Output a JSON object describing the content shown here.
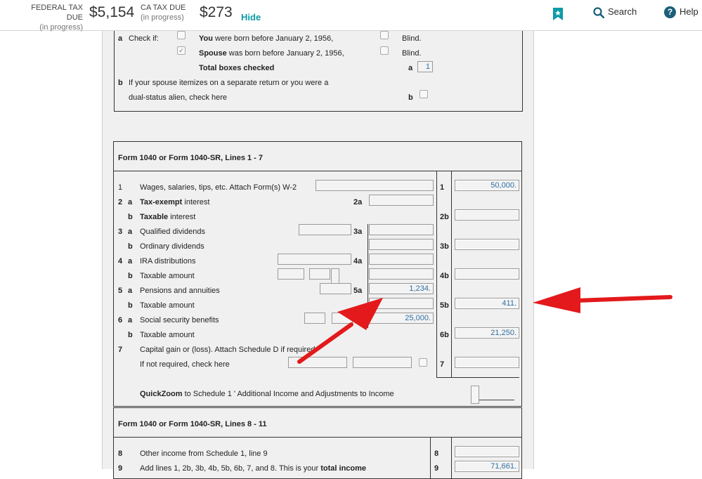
{
  "header": {
    "federal": {
      "label": "FEDERAL TAX DUE",
      "sub": "(in progress)",
      "amount": "$5,154"
    },
    "ca": {
      "label": "CA TAX DUE",
      "sub": "(in progress)",
      "amount": "$273"
    },
    "hide_label": "Hide",
    "search_label": "Search",
    "help_label": "Help",
    "help_glyph": "?",
    "icons": {
      "bookmark": "bookmark-icon",
      "search": "search-icon",
      "help": "help-icon"
    },
    "accent_color": "#0d9aa8"
  },
  "top_section": {
    "a_letter": "a",
    "check_if": "Check if:",
    "you_bold": "You",
    "you_rest": "were born before January 2, 1956,",
    "spouse_bold": "Spouse",
    "spouse_rest": "was born before January 2, 1956,",
    "blind1": "Blind.",
    "blind2": "Blind.",
    "total_label": "Total boxes checked",
    "total_letter": "a",
    "total_value": "1",
    "b_letter": "b",
    "b_line1": "If your spouse itemizes on a separate return or you were a",
    "b_line2": "dual-status alien, check here",
    "b_box_letter": "b",
    "spouse_checked": true
  },
  "section1": {
    "title": "Form 1040 or Form 1040-SR, Lines 1 - 7",
    "lines": {
      "l1": {
        "num": "1",
        "label": "Wages, salaries, tips, etc. Attach Form(s) W-2",
        "ref": "1",
        "value": "50,000."
      },
      "l2a": {
        "num": "2",
        "sub": "a",
        "bold": "Tax-exempt",
        "label": "interest",
        "ref": "2a"
      },
      "l2b": {
        "sub": "b",
        "bold": "Taxable",
        "label": "interest",
        "ref": "2b"
      },
      "l3a": {
        "num": "3",
        "sub": "a",
        "label": "Qualified dividends",
        "ref": "3a"
      },
      "l3b": {
        "sub": "b",
        "label": "Ordinary dividends",
        "ref": "3b"
      },
      "l4a": {
        "num": "4",
        "sub": "a",
        "label": "IRA distributions",
        "ref": "4a"
      },
      "l4b": {
        "sub": "b",
        "label": "Taxable amount",
        "ref": "4b"
      },
      "l5a": {
        "num": "5",
        "sub": "a",
        "label": "Pensions and annuities",
        "ref": "5a",
        "value": "1,234."
      },
      "l5b": {
        "sub": "b",
        "label": "Taxable amount",
        "ref": "5b",
        "value": "411."
      },
      "l6a": {
        "num": "6",
        "sub": "a",
        "label": "Social security benefits",
        "value": "25,000."
      },
      "l6b": {
        "sub": "b",
        "label": "Taxable amount",
        "ref": "6b",
        "value": "21,250."
      },
      "l7": {
        "num": "7",
        "label": "Capital gain or (loss). Attach Schedule D if required.",
        "label2": "If not required, check here",
        "ref": "7"
      }
    },
    "quickzoom_bold": "QuickZoom",
    "quickzoom_rest": "to Schedule 1 ' Additional Income and Adjustments to Income"
  },
  "section2": {
    "title": "Form 1040 or Form 1040-SR, Lines 8 - 11",
    "l8": {
      "num": "8",
      "label": "Other income from Schedule 1, line 9",
      "ref": "8"
    },
    "l9": {
      "num": "9",
      "label": "Add lines 1, 2b, 3b, 4b, 5b, 6b, 7, and 8. This is your",
      "bold": "total income",
      "ref": "9",
      "value": "71,661."
    }
  },
  "annotation_color": "#e3191b"
}
